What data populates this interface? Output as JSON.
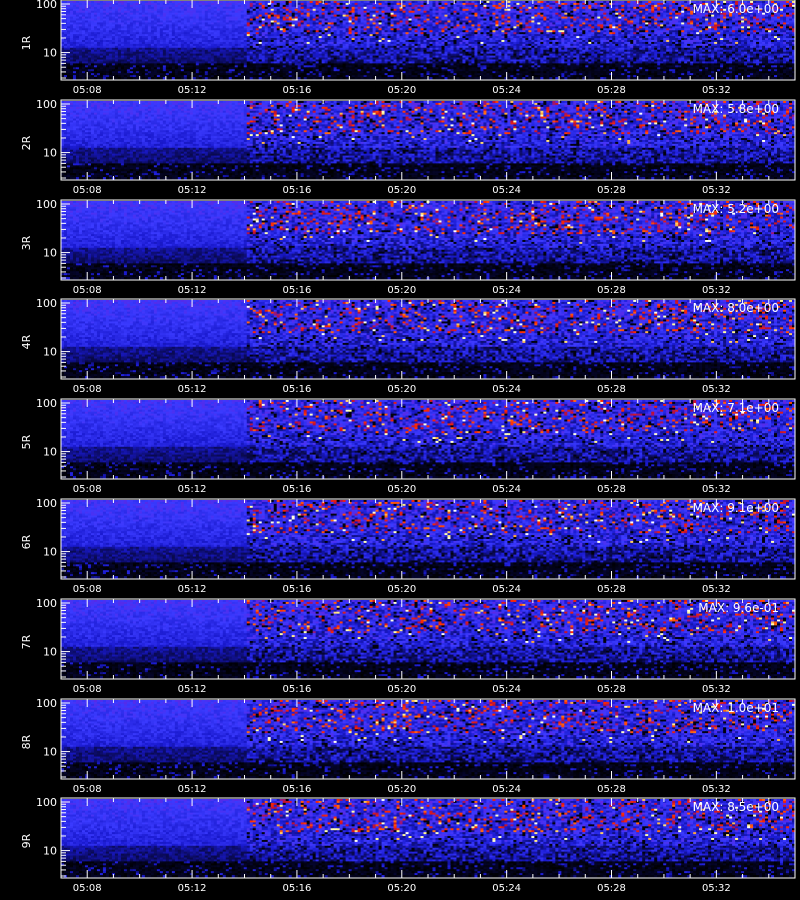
{
  "colors": {
    "background": "#000000",
    "frame": "#ffffff",
    "text": "#ffffff",
    "colormap": [
      "#000000",
      "#0a0a55",
      "#1a1ad0",
      "#3b3bff",
      "#6a1fd8",
      "#c01030",
      "#ff2a00",
      "#ff8c1a",
      "#ffffa0",
      "#ffffff"
    ]
  },
  "chart_data": [
    {
      "type": "heatmap",
      "ylabel": "1R",
      "max_label": "MAX: 6.0e+00",
      "max_value": 6.0,
      "y_scale": "log",
      "ylim": [
        3,
        110
      ],
      "y_tick_labels": [
        "10",
        "100"
      ],
      "y_ticks": [
        10,
        100
      ],
      "x_tick_labels": [
        "05:08",
        "05:12",
        "05:16",
        "05:20",
        "05:24",
        "05:28",
        "05:32"
      ],
      "x_ticks": [
        "05:08",
        "05:12",
        "05:16",
        "05:20",
        "05:24",
        "05:28",
        "05:32"
      ],
      "xlim": [
        "05:07",
        "05:35"
      ],
      "change_time": "05:14",
      "grid": false
    },
    {
      "type": "heatmap",
      "ylabel": "2R",
      "max_label": "MAX: 5.8e+00",
      "max_value": 5.8,
      "y_scale": "log",
      "ylim": [
        3,
        110
      ],
      "y_tick_labels": [
        "10",
        "100"
      ],
      "y_ticks": [
        10,
        100
      ],
      "x_tick_labels": [
        "05:08",
        "05:12",
        "05:16",
        "05:20",
        "05:24",
        "05:28",
        "05:32"
      ],
      "x_ticks": [
        "05:08",
        "05:12",
        "05:16",
        "05:20",
        "05:24",
        "05:28",
        "05:32"
      ],
      "xlim": [
        "05:07",
        "05:35"
      ],
      "change_time": "05:14",
      "grid": false
    },
    {
      "type": "heatmap",
      "ylabel": "3R",
      "max_label": "MAX: 5.2e+00",
      "max_value": 5.2,
      "y_scale": "log",
      "ylim": [
        3,
        110
      ],
      "y_tick_labels": [
        "10",
        "100"
      ],
      "y_ticks": [
        10,
        100
      ],
      "x_tick_labels": [
        "05:08",
        "05:12",
        "05:16",
        "05:20",
        "05:24",
        "05:28",
        "05:32"
      ],
      "x_ticks": [
        "05:08",
        "05:12",
        "05:16",
        "05:20",
        "05:24",
        "05:28",
        "05:32"
      ],
      "xlim": [
        "05:07",
        "05:35"
      ],
      "change_time": "05:14",
      "grid": false
    },
    {
      "type": "heatmap",
      "ylabel": "4R",
      "max_label": "MAX: 8.0e+00",
      "max_value": 8.0,
      "y_scale": "log",
      "ylim": [
        3,
        110
      ],
      "y_tick_labels": [
        "10",
        "100"
      ],
      "y_ticks": [
        10,
        100
      ],
      "x_tick_labels": [
        "05:08",
        "05:12",
        "05:16",
        "05:20",
        "05:24",
        "05:28",
        "05:32"
      ],
      "x_ticks": [
        "05:08",
        "05:12",
        "05:16",
        "05:20",
        "05:24",
        "05:28",
        "05:32"
      ],
      "xlim": [
        "05:07",
        "05:35"
      ],
      "change_time": "05:14",
      "grid": false
    },
    {
      "type": "heatmap",
      "ylabel": "5R",
      "max_label": "MAX: 7.1e+00",
      "max_value": 7.1,
      "y_scale": "log",
      "ylim": [
        3,
        110
      ],
      "y_tick_labels": [
        "10",
        "100"
      ],
      "y_ticks": [
        10,
        100
      ],
      "x_tick_labels": [
        "05:08",
        "05:12",
        "05:16",
        "05:20",
        "05:24",
        "05:28",
        "05:32"
      ],
      "x_ticks": [
        "05:08",
        "05:12",
        "05:16",
        "05:20",
        "05:24",
        "05:28",
        "05:32"
      ],
      "xlim": [
        "05:07",
        "05:35"
      ],
      "change_time": "05:14",
      "grid": false
    },
    {
      "type": "heatmap",
      "ylabel": "6R",
      "max_label": "MAX: 9.1e+00",
      "max_value": 9.1,
      "y_scale": "log",
      "ylim": [
        3,
        110
      ],
      "y_tick_labels": [
        "10",
        "100"
      ],
      "y_ticks": [
        10,
        100
      ],
      "x_tick_labels": [
        "05:08",
        "05:12",
        "05:16",
        "05:20",
        "05:24",
        "05:28",
        "05:32"
      ],
      "x_ticks": [
        "05:08",
        "05:12",
        "05:16",
        "05:20",
        "05:24",
        "05:28",
        "05:32"
      ],
      "xlim": [
        "05:07",
        "05:35"
      ],
      "change_time": "05:14",
      "grid": false
    },
    {
      "type": "heatmap",
      "ylabel": "7R",
      "max_label": "MAX: 9.6e-01",
      "max_value": 0.96,
      "y_scale": "log",
      "ylim": [
        3,
        110
      ],
      "y_tick_labels": [
        "10",
        "100"
      ],
      "y_ticks": [
        10,
        100
      ],
      "x_tick_labels": [
        "05:08",
        "05:12",
        "05:16",
        "05:20",
        "05:24",
        "05:28",
        "05:32"
      ],
      "x_ticks": [
        "05:08",
        "05:12",
        "05:16",
        "05:20",
        "05:24",
        "05:28",
        "05:32"
      ],
      "xlim": [
        "05:07",
        "05:35"
      ],
      "change_time": "05:14",
      "grid": false
    },
    {
      "type": "heatmap",
      "ylabel": "8R",
      "max_label": "MAX: 1.0e+01",
      "max_value": 10.0,
      "y_scale": "log",
      "ylim": [
        3,
        110
      ],
      "y_tick_labels": [
        "10",
        "100"
      ],
      "y_ticks": [
        10,
        100
      ],
      "x_tick_labels": [
        "05:08",
        "05:12",
        "05:16",
        "05:20",
        "05:24",
        "05:28",
        "05:32"
      ],
      "x_ticks": [
        "05:08",
        "05:12",
        "05:16",
        "05:20",
        "05:24",
        "05:28",
        "05:32"
      ],
      "xlim": [
        "05:07",
        "05:35"
      ],
      "change_time": "05:14",
      "grid": false
    },
    {
      "type": "heatmap",
      "ylabel": "9R",
      "max_label": "MAX: 8.5e+00",
      "max_value": 8.5,
      "y_scale": "log",
      "ylim": [
        3,
        110
      ],
      "y_tick_labels": [
        "10",
        "100"
      ],
      "y_ticks": [
        10,
        100
      ],
      "x_tick_labels": [
        "05:08",
        "05:12",
        "05:16",
        "05:20",
        "05:24",
        "05:28",
        "05:32"
      ],
      "x_ticks": [
        "05:08",
        "05:12",
        "05:16",
        "05:20",
        "05:24",
        "05:28",
        "05:32"
      ],
      "xlim": [
        "05:07",
        "05:35"
      ],
      "change_time": "05:14",
      "grid": false
    }
  ]
}
